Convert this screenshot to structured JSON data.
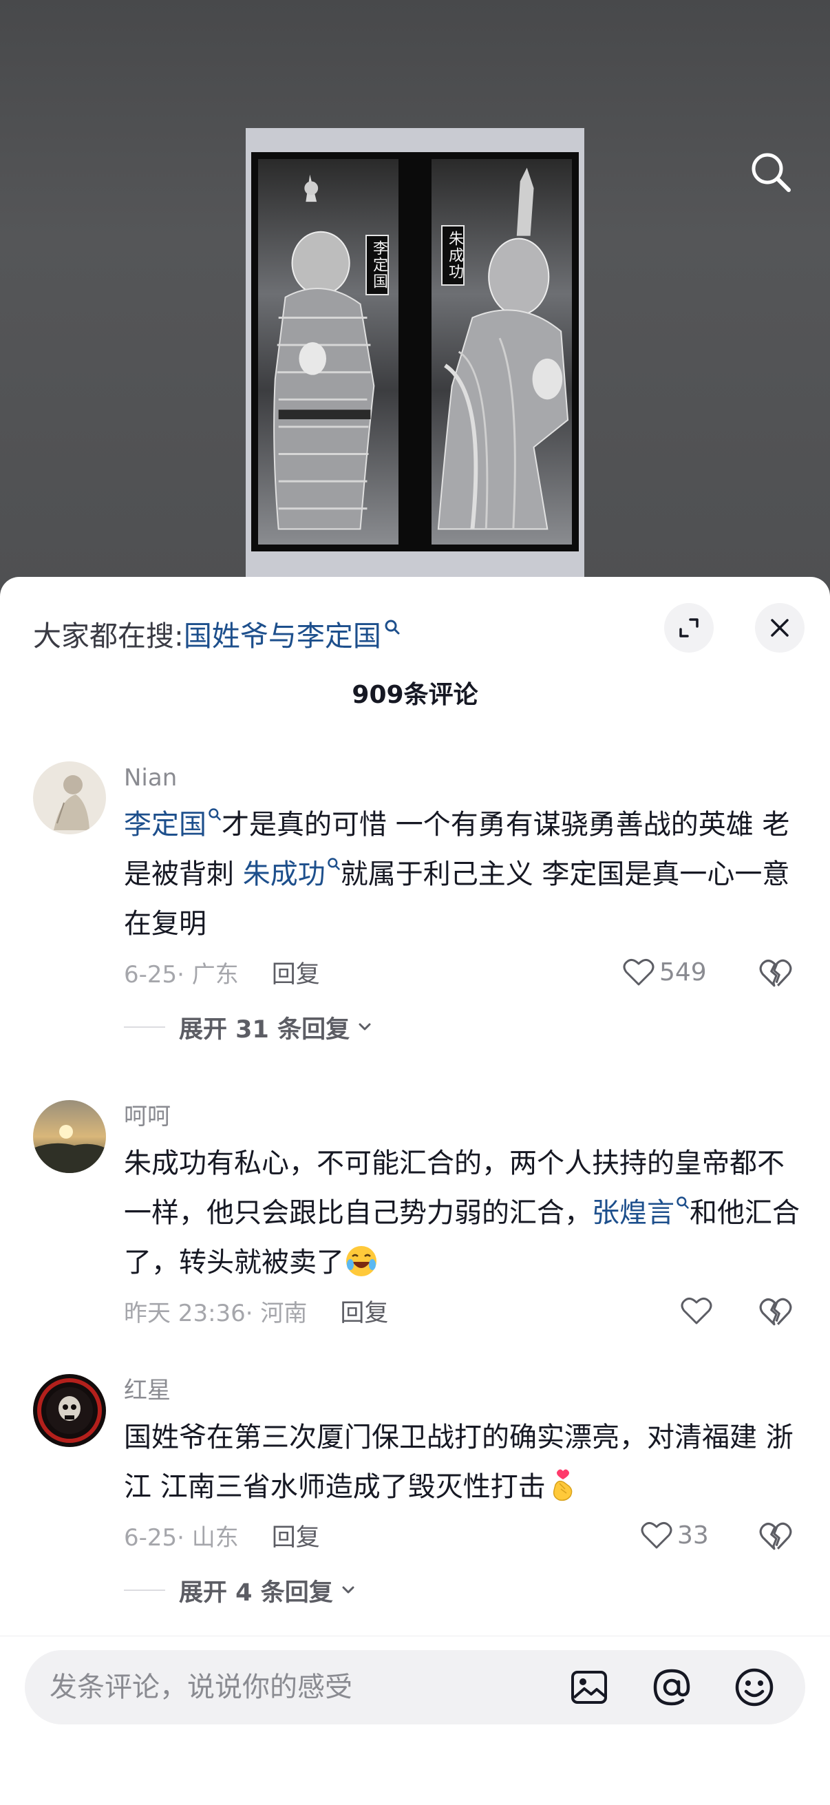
{
  "video": {
    "poster_left_name": "李定国",
    "poster_right_name": "朱成功",
    "search_icon": "search-icon"
  },
  "sheet": {
    "hot_search_prefix": "大家都在搜:",
    "hot_search_term": "国姓爷与李定国",
    "comment_count": "909条评论",
    "expand_icon": "expand-icon",
    "close_icon": "close-icon"
  },
  "comments": [
    {
      "user": "Nian",
      "text_parts": [
        "李定国",
        "才是真的可惜 一个有勇有谋骁勇善战的英雄 老是被背刺 ",
        "朱成功",
        "就属于利己主义 李定国是真一心一意在复明"
      ],
      "time": "6-25· 广东",
      "reply": "回复",
      "likes": "549",
      "expand": "展开 31 条回复"
    },
    {
      "user": "呵呵",
      "text_parts": [
        "朱成功有私心，不可能汇合的，两个人扶持的皇帝都不一样，他只会跟比自己势力弱的汇合，",
        "张煌言",
        "和他汇合了，转头就被卖了"
      ],
      "emoji": "laughing-crying-emoji",
      "time": "昨天 23:36· 河南",
      "reply": "回复",
      "likes": ""
    },
    {
      "user": "红星",
      "text": "国姓爷在第三次厦门保卫战打的确实漂亮，对清福建 浙江 江南三省水师造成了毁灭性打击",
      "emoji": "finger-heart-emoji",
      "time": "6-25· 山东",
      "reply": "回复",
      "likes": "33",
      "expand": "展开 4 条回复"
    }
  ],
  "input": {
    "placeholder": "发条评论，说说你的感受",
    "icons": [
      "image-icon",
      "at-icon",
      "emoji-icon"
    ]
  }
}
